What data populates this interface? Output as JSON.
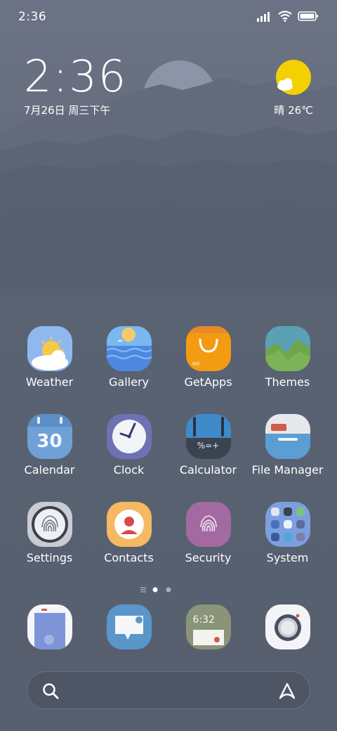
{
  "status_bar": {
    "time": "2:36",
    "icons": [
      "signal-icon",
      "wifi-icon",
      "battery-icon"
    ]
  },
  "clock_widget": {
    "time": "2:36",
    "date": "7月26日 周三下午"
  },
  "weather_widget": {
    "icon": "sun-cloud-icon",
    "text": "晴 26℃"
  },
  "apps": [
    {
      "label": "Weather",
      "icon": "weather-icon"
    },
    {
      "label": "Gallery",
      "icon": "gallery-icon"
    },
    {
      "label": "GetApps",
      "icon": "getapps-icon"
    },
    {
      "label": "Themes",
      "icon": "themes-icon"
    },
    {
      "label": "Calendar",
      "icon": "calendar-icon",
      "icon_text": "30"
    },
    {
      "label": "Clock",
      "icon": "clock-icon"
    },
    {
      "label": "Calculator",
      "icon": "calculator-icon",
      "icon_text": "%=+"
    },
    {
      "label": "File Manager",
      "icon": "file-manager-icon"
    },
    {
      "label": "Settings",
      "icon": "settings-icon"
    },
    {
      "label": "Contacts",
      "icon": "contacts-icon"
    },
    {
      "label": "Security",
      "icon": "security-icon"
    },
    {
      "label": "System",
      "icon": "system-folder-icon"
    }
  ],
  "page_indicator": {
    "pages": 2,
    "current": 1
  },
  "dock": [
    {
      "icon": "phone-icon"
    },
    {
      "icon": "messaging-icon"
    },
    {
      "icon": "notes-icon",
      "icon_text": "6:32"
    },
    {
      "icon": "camera-icon"
    }
  ],
  "search_bar": {
    "icon": "search-icon",
    "assistant_icon": "assistant-icon"
  },
  "colors": {
    "background": "#5b6374",
    "weather_sun": "#f5d000",
    "getapps": "#f39c12"
  }
}
